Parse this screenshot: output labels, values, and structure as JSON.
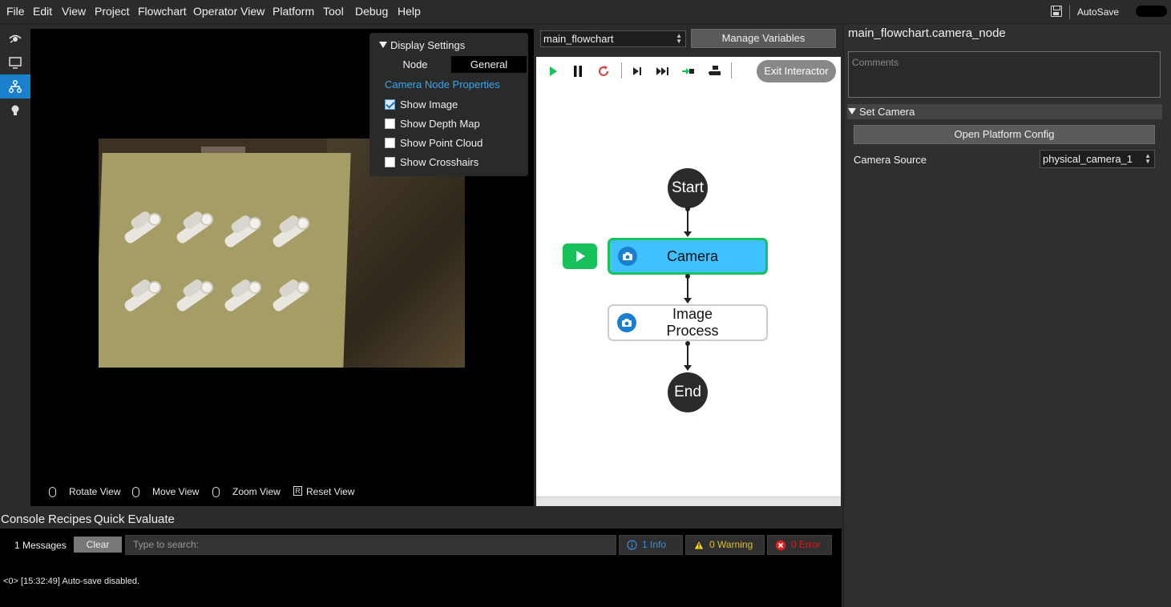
{
  "menu": [
    "File",
    "Edit",
    "View",
    "Project",
    "Flowchart",
    "Operator View",
    "Platform",
    "Tool",
    "Debug",
    "Help"
  ],
  "autosave": {
    "label": "AutoSave",
    "enabled": false
  },
  "viewer": {
    "view_controls": [
      "Rotate View",
      "Move View",
      "Zoom View",
      "Reset View"
    ],
    "reset_key": "R"
  },
  "display_settings": {
    "title": "Display Settings",
    "tabs": [
      "Node",
      "General"
    ],
    "active_tab": "General",
    "section_title": "Camera Node Properties",
    "options": [
      {
        "label": "Show Image",
        "checked": true
      },
      {
        "label": "Show Depth Map",
        "checked": false
      },
      {
        "label": "Show Point Cloud",
        "checked": false
      },
      {
        "label": "Show Crosshairs",
        "checked": false
      }
    ]
  },
  "flowchart": {
    "selected": "main_flowchart",
    "manage_variables": "Manage Variables",
    "exit_interactor": "Exit Interactor",
    "nodes": {
      "start": "Start",
      "camera": "Camera",
      "image_process": "Image Process",
      "end": "End"
    }
  },
  "properties": {
    "node_path": "main_flowchart.camera_node",
    "comments_placeholder": "Comments",
    "section": "Set Camera",
    "open_platform_config": "Open Platform Config",
    "camera_source_label": "Camera Source",
    "camera_source_value": "physical_camera_1"
  },
  "console": {
    "tabs": [
      "Console",
      "Recipes",
      "Quick Evaluate"
    ],
    "message_count": "1 Messages",
    "clear": "Clear",
    "search_placeholder": "Type to search:",
    "info": "1 Info",
    "warning": "0 Warning",
    "error": "0 Error",
    "log": "<0> [15:32:49] Auto-save disabled."
  },
  "colors": {
    "accent": "#1a80cc",
    "node_active": "#3fc0ff",
    "run_green": "#18c25a",
    "info": "#3b8ed6",
    "warning": "#e0c020",
    "error": "#cc2020"
  }
}
